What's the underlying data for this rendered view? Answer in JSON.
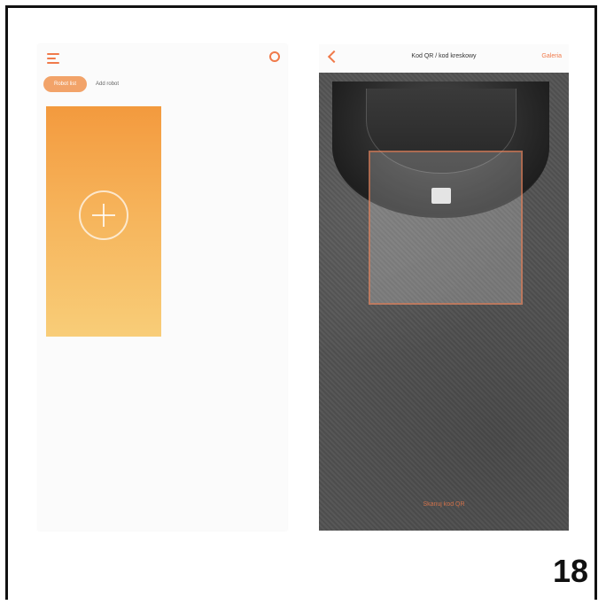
{
  "left_screen": {
    "tabs": [
      {
        "label": "Robot list"
      },
      {
        "label": "Add robot"
      }
    ]
  },
  "right_screen": {
    "title": "Kod QR / kod kreskowy",
    "action": "Galeria",
    "bottom_hint": "Skanuj kod QR"
  },
  "page_number": "18"
}
